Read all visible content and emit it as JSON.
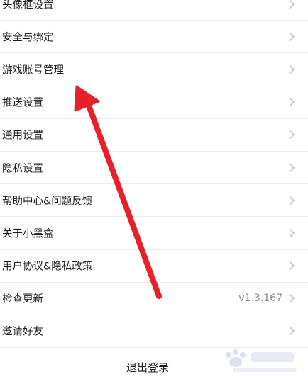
{
  "settings": {
    "items": [
      {
        "label": "头像框设置",
        "value": ""
      },
      {
        "label": "安全与绑定",
        "value": ""
      },
      {
        "label": "游戏账号管理",
        "value": ""
      },
      {
        "label": "推送设置",
        "value": ""
      },
      {
        "label": "通用设置",
        "value": ""
      },
      {
        "label": "隐私设置",
        "value": ""
      },
      {
        "label": "帮助中心&问题反馈",
        "value": ""
      },
      {
        "label": "关于小黑盒",
        "value": ""
      },
      {
        "label": "用户协议&隐私政策",
        "value": ""
      },
      {
        "label": "检查更新",
        "value": "v1.3.167"
      },
      {
        "label": "邀请好友",
        "value": ""
      }
    ],
    "logout_label": "退出登录"
  },
  "icons": {
    "row_chevron": "chevron-right-icon",
    "annotation": "red-arrow-annotation",
    "watermark": "baidu-jingyan-watermark"
  },
  "colors": {
    "annotation_arrow": "#e8202a",
    "chevron": "#c4c4c4",
    "divider": "#ececec",
    "value_text": "#8a8a8a"
  }
}
